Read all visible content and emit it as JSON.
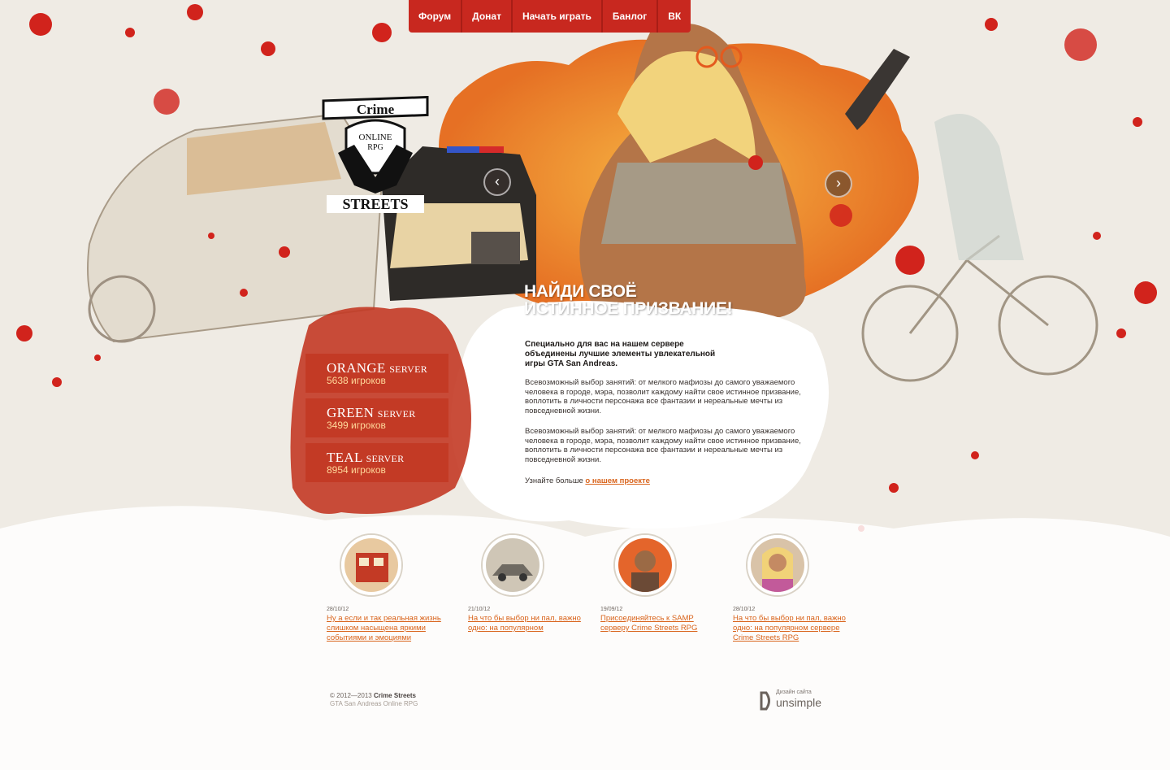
{
  "nav": {
    "items": [
      "Форум",
      "Донат",
      "Начать играть",
      "Банлог",
      "ВК"
    ]
  },
  "logo": {
    "top": "Crime",
    "middle_1": "ONLINE",
    "middle_2": "RPG",
    "bottom": "STREETS"
  },
  "slider": {
    "prev_icon": "chevron-left-icon",
    "next_icon": "chevron-right-icon"
  },
  "hero": {
    "headline_1": "Найди своё",
    "headline_2": "истинное призвание!"
  },
  "content": {
    "intro": "Специально для вас на нашем сервере объединены лучшие элементы увлекательной игры GTA San Andreas.",
    "para_1": "Всевозможный выбор занятий: от мелкого мафиозы до самого уважаемого человека в городе, мэра, позволит каждому найти свое истинное призвание, воплотить в личности персонажа все фантазии и нереальные мечты из повседневной жизни.",
    "para_2": "Всевозможный выбор занятий: от мелкого мафиозы до самого уважаемого человека в городе, мэра, позволит каждому найти свое истинное призвание, воплотить в личности персонажа все фантазии и нереальные мечты из повседневной жизни.",
    "learn_prefix": "Узнайте больше",
    "learn_link": "о нашем проекте"
  },
  "servers": [
    {
      "name": "ORANGE",
      "suffix": "SERVER",
      "players": "5638 игроков"
    },
    {
      "name": "GREEN",
      "suffix": "SERVER",
      "players": "3499 игроков"
    },
    {
      "name": "TEAL",
      "suffix": "SERVER",
      "players": "8954 игроков"
    }
  ],
  "news": [
    {
      "date": "28/10/12",
      "title": "Ну а если и так реальная жизнь слишком насыщена яркими событиями и эмоциями"
    },
    {
      "date": "21/10/12",
      "title": "На что бы выбор ни пал, важно одно: на популярном"
    },
    {
      "date": "19/09/12",
      "title": "Присоединяйтесь к SAMP серверу Crime Streets RPG"
    },
    {
      "date": "28/10/12",
      "title": "На что бы выбор ни пал, важно одно: на популярном сервере Crime Streets RPG"
    }
  ],
  "footer": {
    "copyright_prefix": "© 2012—2013",
    "copyright_brand": "Crime Streets",
    "copyright_sub": "GTA San Andreas Online RPG",
    "design_label": "Дизайн сайта",
    "design_brand": "unsimple"
  },
  "colors": {
    "accent": "#c8281f",
    "link": "#d9641c",
    "background": "#efebe4"
  }
}
